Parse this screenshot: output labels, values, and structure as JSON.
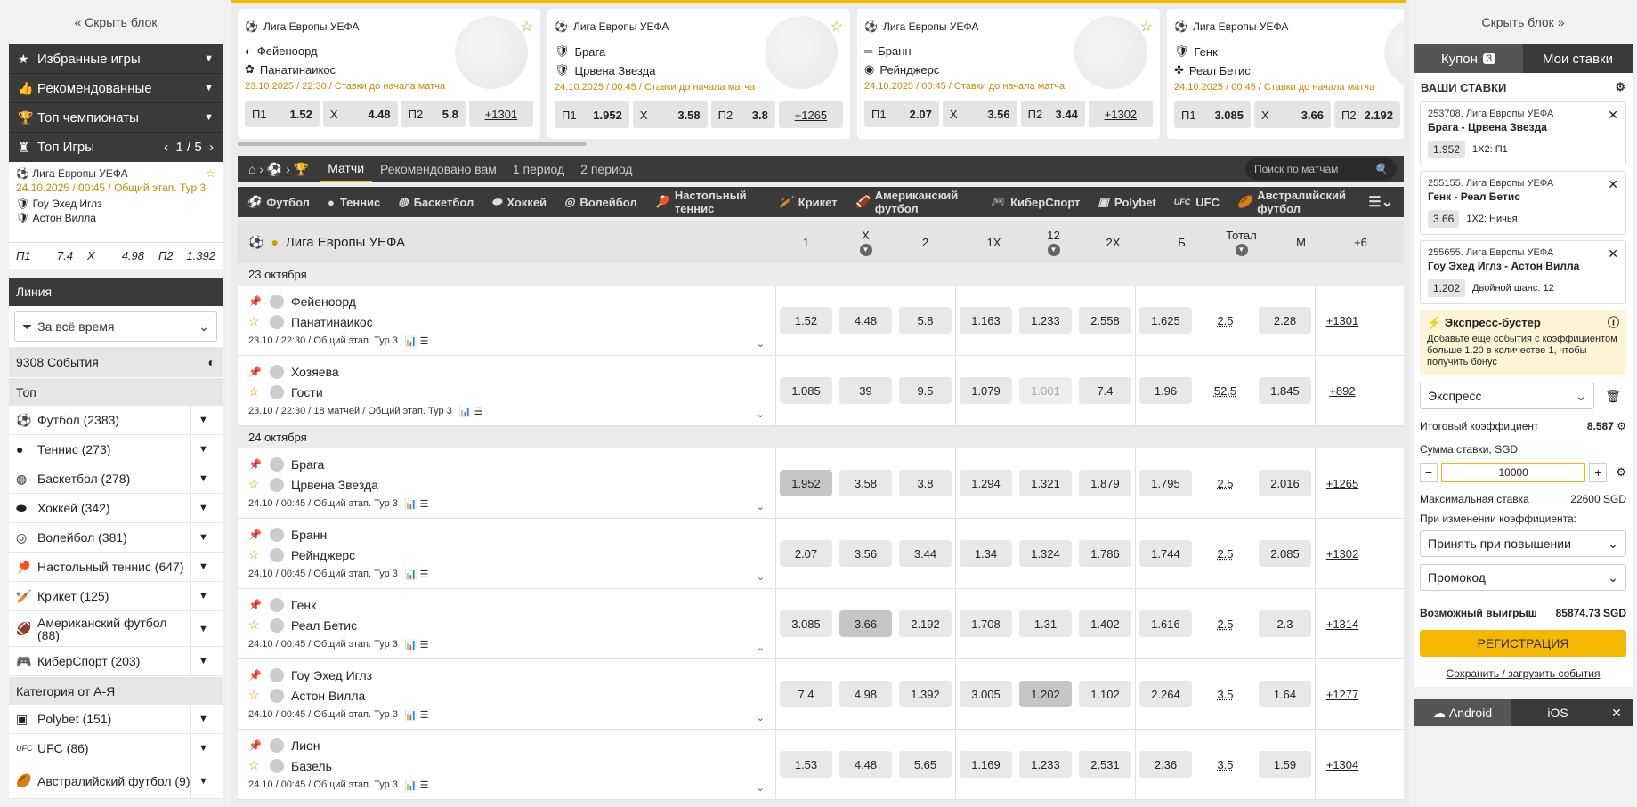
{
  "left": {
    "hide_label": "« Скрыть блок",
    "groups": [
      {
        "label": "Избранные игры",
        "icon": "star-icon"
      },
      {
        "label": "Рекомендованные",
        "icon": "thumbs-up-icon"
      },
      {
        "label": "Топ чемпионаты",
        "icon": "trophy-icon"
      }
    ],
    "top_games": {
      "label": "Топ Игры",
      "pager": "1 / 5",
      "league": "Лига Европы УЕФА",
      "date": "24.10.2025 / 00:45 / Общий этап. Тур 3",
      "team1": "Гоу Эхед Иглз",
      "team2": "Астон Вилла",
      "p1": "П1",
      "v1": "7.4",
      "x": "X",
      "vx": "4.98",
      "p2": "П2",
      "v2": "1.392"
    },
    "line_label": "Линия",
    "period": "За всё время",
    "events": "9308 События",
    "top_label": "Топ",
    "sports": [
      "Футбол (2383)",
      "Теннис (273)",
      "Баскетбол (278)",
      "Хоккей (342)",
      "Волейбол (381)",
      "Настольный теннис (647)",
      "Крикет (125)",
      "Американский футбол (88)",
      "КиберСпорт (203)"
    ],
    "category_label": "Категория от А-Я",
    "sports2": [
      "Polybet (151)",
      "UFC (86)",
      "Австралийский футбол (9)"
    ]
  },
  "cards": [
    {
      "league": "Лига Европы УЕФА",
      "t1": "Фейеноорд",
      "t2": "Панатинаикос",
      "date": "23.10.2025 / 22:30 / Ставки до начала матча",
      "p1": "1.52",
      "x": "4.48",
      "p2": "5.8",
      "more": "+1301"
    },
    {
      "league": "Лига Европы УЕФА",
      "t1": "Брага",
      "t2": "Црвена Звезда",
      "date": "24.10.2025 / 00:45 / Ставки до начала матча",
      "p1": "1.952",
      "x": "3.58",
      "p2": "3.8",
      "more": "+1265"
    },
    {
      "league": "Лига Европы УЕФА",
      "t1": "Бранн",
      "t2": "Рейнджерс",
      "date": "24.10.2025 / 00:45 / Ставки до начала матча",
      "p1": "2.07",
      "x": "3.56",
      "p2": "3.44",
      "more": "+1302"
    },
    {
      "league": "Лига Европы УЕФА",
      "t1": "Генк",
      "t2": "Реал Бетис",
      "date": "24.10.2025 / 00:45 / Ставки до начала матча",
      "p1": "3.085",
      "x": "3.66",
      "p2": "2.192",
      "more": ""
    }
  ],
  "labels": {
    "p1": "П1",
    "x": "X",
    "p2": "П2"
  },
  "nav": {
    "tabs": [
      "Матчи",
      "Рекомендовано вам",
      "1 период",
      "2 период"
    ],
    "search": "Поиск по матчам"
  },
  "sports_bar": [
    "Футбол",
    "Теннис",
    "Баскетбол",
    "Хоккей",
    "Волейбол",
    "Настольный теннис",
    "Крикет",
    "Американский футбол",
    "КиберСпорт",
    "Polybet",
    "UFC",
    "Австралийский футбол"
  ],
  "table": {
    "league": "Лига Европы УЕФА",
    "cols": [
      "1",
      "X",
      "2",
      "1X",
      "12",
      "2X",
      "Б",
      "Тотал",
      "М",
      "+6"
    ],
    "sections": [
      {
        "date": "23 октября",
        "matches": [
          {
            "t1": "Фейеноорд",
            "t2": "Панатинаикос",
            "meta": "23.10 / 22:30 / Общий этап. Тур 3",
            "odds": [
              "1.52",
              "4.48",
              "5.8",
              "1.163",
              "1.233",
              "2.558",
              "1.625",
              "2.5",
              "2.28"
            ],
            "more": "+1301"
          },
          {
            "t1": "Хозяева",
            "t2": "Гости",
            "meta": "23.10 / 22:30 / 18 матчей / Общий этап. Тур 3",
            "odds": [
              "1.085",
              "39",
              "9.5",
              "1.079",
              "1.001",
              "7.4",
              "1.96",
              "52.5",
              "1.845"
            ],
            "more": "+892"
          }
        ]
      },
      {
        "date": "24 октября",
        "matches": [
          {
            "t1": "Брага",
            "t2": "Црвена Звезда",
            "meta": "24.10 / 00:45 / Общий этап. Тур 3",
            "odds": [
              "1.952",
              "3.58",
              "3.8",
              "1.294",
              "1.321",
              "1.879",
              "1.795",
              "2.5",
              "2.016"
            ],
            "more": "+1265"
          },
          {
            "t1": "Бранн",
            "t2": "Рейнджерс",
            "meta": "24.10 / 00:45 / Общий этап. Тур 3",
            "odds": [
              "2.07",
              "3.56",
              "3.44",
              "1.34",
              "1.324",
              "1.786",
              "1.744",
              "2.5",
              "2.085"
            ],
            "more": "+1302"
          },
          {
            "t1": "Генк",
            "t2": "Реал Бетис",
            "meta": "24.10 / 00:45 / Общий этап. Тур 3",
            "odds": [
              "3.085",
              "3.66",
              "2.192",
              "1.708",
              "1.31",
              "1.402",
              "1.616",
              "2.5",
              "2.3"
            ],
            "more": "+1314"
          },
          {
            "t1": "Гоу Эхед Иглз",
            "t2": "Астон Вилла",
            "meta": "24.10 / 00:45 / Общий этап. Тур 3",
            "odds": [
              "7.4",
              "4.98",
              "1.392",
              "3.005",
              "1.202",
              "1.102",
              "2.264",
              "3.5",
              "1.64"
            ],
            "more": "+1277"
          },
          {
            "t1": "Лион",
            "t2": "Базель",
            "meta": "24.10 / 00:45 / Общий этап. Тур 3",
            "odds": [
              "1.53",
              "4.48",
              "5.65",
              "1.169",
              "1.233",
              "2.531",
              "2.36",
              "3.5",
              "1.59"
            ],
            "more": "+1304"
          }
        ]
      }
    ]
  },
  "right": {
    "hide_label": "Скрыть блок »",
    "tab_coupon": "Купон",
    "coupon_count": "3",
    "tab_bets": "Мои ставки",
    "your_bets": "ВАШИ СТАВКИ",
    "bets": [
      {
        "h": "253708. Лига Европы УЕФА",
        "m": "Брага - Црвена Звезда",
        "odd": "1.952",
        "type": "1Х2: П1"
      },
      {
        "h": "255155. Лига Европы УЕФА",
        "m": "Генк - Реал Бетис",
        "odd": "3.66",
        "type": "1Х2: Ничья"
      },
      {
        "h": "255655. Лига Европы УЕФА",
        "m": "Гоу Эхед Иглз - Астон Вилла",
        "odd": "1.202",
        "type": "Двойной шанс: 12"
      }
    ],
    "boost_title": "Экспресс-бустер",
    "boost_text": "Добавьте еще события с коэффициентом больше 1.20 в количестве 1, чтобы получить бонус",
    "bet_type": "Экспресс",
    "total_label": "Итоговый коэффициент",
    "total_value": "8.587",
    "stake_label": "Сумма ставки, SGD",
    "stake_value": "10000",
    "max_label": "Максимальная ставка",
    "max_value": "22600 SGD",
    "change_label": "При изменении коэффициента:",
    "change_value": "Принять при повышении",
    "promo": "Промокод",
    "win_label": "Возможный выигрыш",
    "win_value": "85874.73 SGD",
    "register": "РЕГИСТРАЦИЯ",
    "save": "Сохранить / загрузить события",
    "android": "Android",
    "ios": "iOS"
  }
}
